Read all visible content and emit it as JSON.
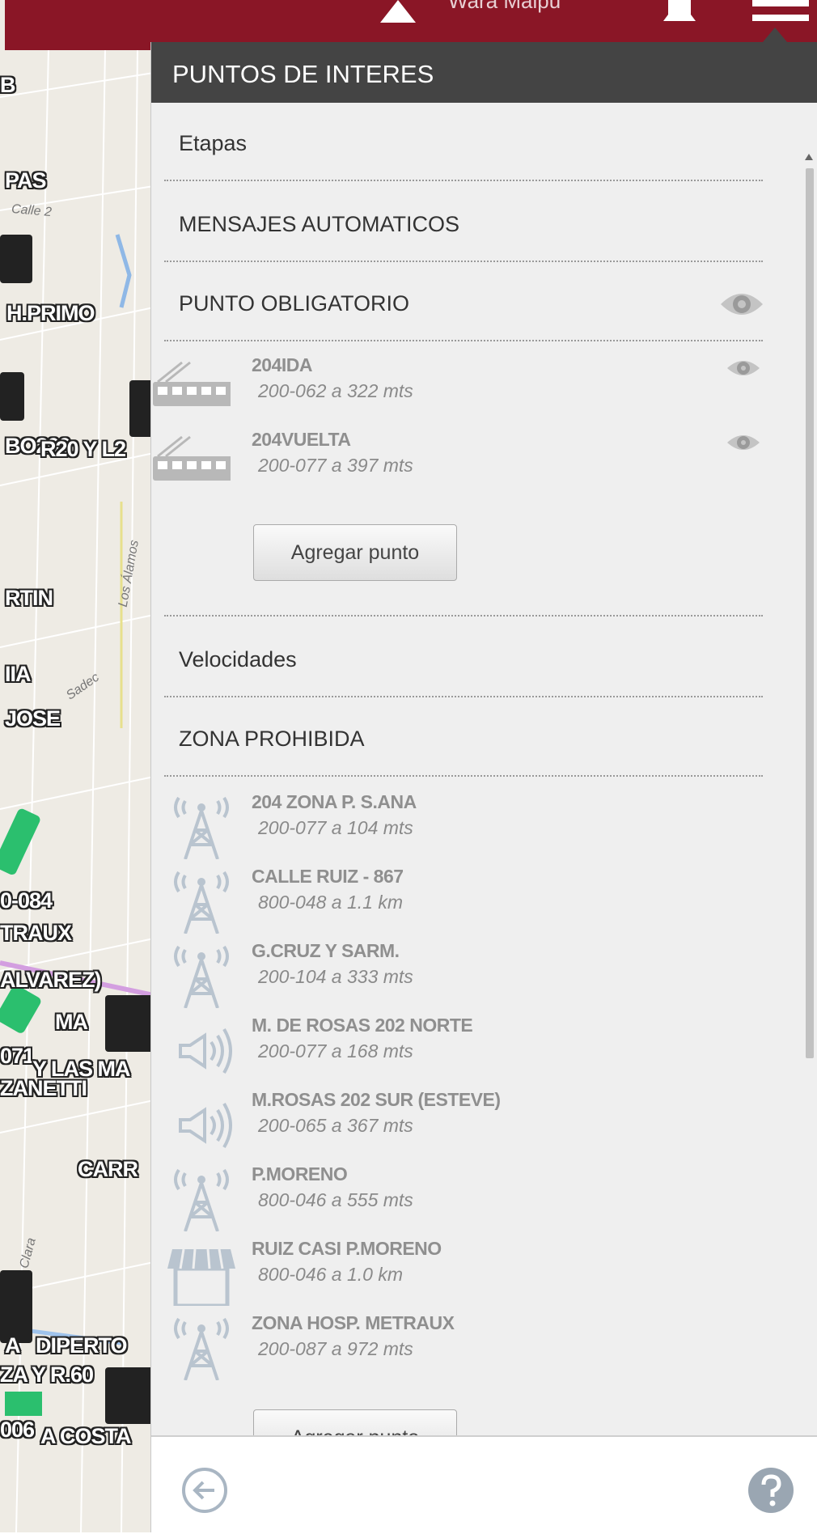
{
  "app": {
    "title": "Wara Maipu",
    "accent_color": "#8a1626"
  },
  "map": {
    "labels": [
      "B",
      "PAS",
      "H.PRIMO",
      "BO200",
      "R20 Y L2",
      "RTIN",
      "IIA",
      "JOSE",
      "0-084",
      "TRAUX",
      "ALVAREZ)",
      "MA",
      "071",
      "Y LAS MA",
      "ZANETTI",
      "CARR",
      "A",
      "DIPERTO",
      "ZA Y R.60",
      "006",
      "A COSTA"
    ],
    "streets": [
      "Calle 2",
      "Los Álamos",
      "Sadec",
      "Clara"
    ]
  },
  "panel": {
    "header": "PUNTOS DE INTERES",
    "sections": {
      "etapas": "Etapas",
      "mensajes": "MENSAJES AUTOMATICOS",
      "punto_obligatorio": "PUNTO OBLIGATORIO",
      "velocidades": "Velocidades",
      "zona_prohibida": "ZONA PROHIBIDA"
    },
    "punto_obligatorio_items": [
      {
        "title": "204IDA",
        "subtitle": "200-062 a 322 mts",
        "icon": "bus-icon"
      },
      {
        "title": "204VUELTA",
        "subtitle": "200-077 a 397 mts",
        "icon": "bus-icon"
      }
    ],
    "zona_prohibida_items": [
      {
        "title": "204 ZONA P. S.ANA",
        "subtitle": "200-077 a 104 mts",
        "icon": "antenna-icon"
      },
      {
        "title": "CALLE RUIZ - 867",
        "subtitle": "800-048 a 1.1 km",
        "icon": "antenna-icon"
      },
      {
        "title": "G.CRUZ Y SARM.",
        "subtitle": "200-104 a 333 mts",
        "icon": "antenna-icon"
      },
      {
        "title": "M. DE ROSAS 202 NORTE",
        "subtitle": "200-077 a 168 mts",
        "icon": "speaker-icon"
      },
      {
        "title": "M.ROSAS 202 SUR (ESTEVE)",
        "subtitle": "200-065 a 367 mts",
        "icon": "speaker-icon"
      },
      {
        "title": "P.MORENO",
        "subtitle": "800-046 a 555 mts",
        "icon": "antenna-icon"
      },
      {
        "title": "RUIZ CASI P.MORENO",
        "subtitle": "800-046 a 1.0 km",
        "icon": "store-icon"
      },
      {
        "title": "ZONA HOSP. METRAUX",
        "subtitle": "200-087 a 972 mts",
        "icon": "antenna-icon"
      }
    ],
    "add_point_label": "Agregar punto"
  }
}
